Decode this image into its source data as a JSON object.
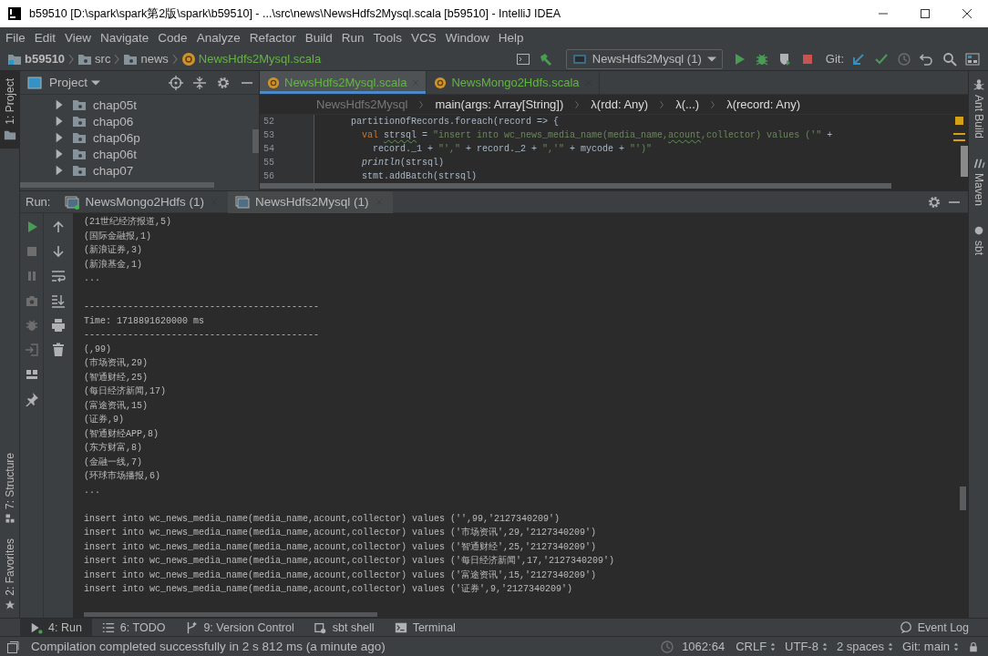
{
  "window": {
    "title": "b59510 [D:\\spark\\spark第2版\\spark\\b59510] - ...\\src\\news\\NewsHdfs2Mysql.scala [b59510] - IntelliJ IDEA"
  },
  "menu": [
    "File",
    "Edit",
    "View",
    "Navigate",
    "Code",
    "Analyze",
    "Refactor",
    "Build",
    "Run",
    "Tools",
    "VCS",
    "Window",
    "Help"
  ],
  "nav_path": [
    {
      "label": "b59510",
      "kind": "module"
    },
    {
      "label": "src",
      "kind": "folder"
    },
    {
      "label": "news",
      "kind": "folder"
    },
    {
      "label": "NewsHdfs2Mysql.scala",
      "kind": "file"
    }
  ],
  "toolbar": {
    "run_config": "NewsHdfs2Mysql (1)",
    "vcs_label": "Git:"
  },
  "left_strip": {
    "top": [
      {
        "label": "1: Project",
        "selected": true
      }
    ],
    "bottom": [
      {
        "label": "7: Structure",
        "selected": false,
        "kind": "structure"
      },
      {
        "label": "2: Favorites",
        "selected": false,
        "kind": "favorites"
      }
    ]
  },
  "right_strip": [
    {
      "label": "Ant Build",
      "kind": "ant"
    },
    {
      "label": "Maven",
      "kind": "maven"
    },
    {
      "label": "sbt",
      "kind": "sbt"
    }
  ],
  "project_panel": {
    "title": "Project",
    "items": [
      {
        "label": "chap05t",
        "expanded": false
      },
      {
        "label": "chap06",
        "expanded": false
      },
      {
        "label": "chap06p",
        "expanded": false
      },
      {
        "label": "chap06t",
        "expanded": false
      },
      {
        "label": "chap07",
        "expanded": false
      }
    ]
  },
  "editor": {
    "tabs": [
      {
        "label": "NewsHdfs2Mysql.scala",
        "selected": true
      },
      {
        "label": "NewsMongo2Hdfs.scala",
        "selected": false
      }
    ],
    "breadcrumb": [
      "NewsHdfs2Mysql",
      "main(args: Array[String])",
      "λ(rdd: Any)",
      "λ(...)",
      "λ(record: Any)"
    ],
    "lines": [
      {
        "number": "52",
        "tokens": [
          {
            "text": "      partitionOfRecords.foreach(record => {",
            "kind": "plain"
          }
        ]
      },
      {
        "number": "53",
        "tokens": [
          {
            "text": "        val ",
            "kind": "keyword"
          },
          {
            "text": "strsql",
            "kind": "typo"
          },
          {
            "text": " = ",
            "kind": "plain"
          },
          {
            "text": "\"insert into wc_news_media_name(media_name,",
            "kind": "string"
          },
          {
            "text": "acount",
            "kind": "string-typo"
          },
          {
            "text": ",collector) values ('\"",
            "kind": "string"
          },
          {
            "text": " +",
            "kind": "plain"
          }
        ]
      },
      {
        "number": "54",
        "tokens": [
          {
            "text": "          record._1 + ",
            "kind": "plain"
          },
          {
            "text": "\"',\"",
            "kind": "string"
          },
          {
            "text": " + record._2 + ",
            "kind": "plain"
          },
          {
            "text": "\",'\"",
            "kind": "string"
          },
          {
            "text": " + mycode + ",
            "kind": "plain"
          },
          {
            "text": "\"')\"",
            "kind": "string"
          }
        ]
      },
      {
        "number": "55",
        "tokens": [
          {
            "text": "        println",
            "kind": "italic"
          },
          {
            "text": "(strsql)",
            "kind": "plain"
          }
        ]
      },
      {
        "number": "56",
        "tokens": [
          {
            "text": "        stmt.addBatch(strsql)",
            "kind": "plain"
          }
        ]
      }
    ]
  },
  "run_panel": {
    "label": "Run:",
    "tabs": [
      {
        "label": "NewsMongo2Hdfs (1)",
        "selected": false,
        "running": true
      },
      {
        "label": "NewsHdfs2Mysql (1)",
        "selected": true,
        "running": false
      }
    ],
    "console": [
      {
        "kind": "text",
        "text": "(21世纪经济报道,5)"
      },
      {
        "kind": "text",
        "text": "(国际金融报,1)"
      },
      {
        "kind": "text",
        "text": "(新浪证券,3)"
      },
      {
        "kind": "text",
        "text": "(新浪基金,1)"
      },
      {
        "kind": "text",
        "text": "..."
      },
      {
        "kind": "blank"
      },
      {
        "kind": "text",
        "text": "-------------------------------------------"
      },
      {
        "kind": "text",
        "text": "Time: 1718891620000 ms"
      },
      {
        "kind": "text",
        "text": "-------------------------------------------"
      },
      {
        "kind": "text",
        "text": "(,99)"
      },
      {
        "kind": "text",
        "text": "(市场资讯,29)"
      },
      {
        "kind": "text",
        "text": "(智通财经,25)"
      },
      {
        "kind": "text",
        "text": "(每日经济新闻,17)"
      },
      {
        "kind": "text",
        "text": "(富途资讯,15)"
      },
      {
        "kind": "text",
        "text": "(证券,9)"
      },
      {
        "kind": "text",
        "text": "(智通财经APP,8)"
      },
      {
        "kind": "text",
        "text": "(东方财富,8)"
      },
      {
        "kind": "text",
        "text": "(金融一线,7)"
      },
      {
        "kind": "text",
        "text": "(环球市场播报,6)"
      },
      {
        "kind": "text",
        "text": "..."
      },
      {
        "kind": "blank"
      },
      {
        "kind": "text",
        "text": "insert into wc_news_media_name(media_name,acount,collector) values ('',99,'2127340209')"
      },
      {
        "kind": "text",
        "text": "insert into wc_news_media_name(media_name,acount,collector) values ('市场资讯',29,'2127340209')"
      },
      {
        "kind": "text",
        "text": "insert into wc_news_media_name(media_name,acount,collector) values ('智通财经',25,'2127340209')"
      },
      {
        "kind": "text",
        "text": "insert into wc_news_media_name(media_name,acount,collector) values ('每日经济新闻',17,'2127340209')"
      },
      {
        "kind": "text",
        "text": "insert into wc_news_media_name(media_name,acount,collector) values ('富途资讯',15,'2127340209')"
      },
      {
        "kind": "text",
        "text": "insert into wc_news_media_name(media_name,acount,collector) values ('证券',9,'2127340209')"
      }
    ]
  },
  "bottom_tabs": [
    {
      "label": "4: Run",
      "kind": "run",
      "selected": true
    },
    {
      "label": "6: TODO",
      "kind": "todo",
      "selected": false
    },
    {
      "label": "9: Version Control",
      "kind": "vcs",
      "selected": false
    },
    {
      "label": "sbt shell",
      "kind": "shell",
      "selected": false
    },
    {
      "label": "Terminal",
      "kind": "terminal",
      "selected": false
    }
  ],
  "event_log": "Event Log",
  "status_bar": {
    "message": "Compilation completed successfully in 2 s 812 ms (a minute ago)",
    "position": "1062:64",
    "line_separator": "CRLF",
    "encoding": "UTF-8",
    "indent": "2 spaces",
    "vcs": "Git: main"
  }
}
